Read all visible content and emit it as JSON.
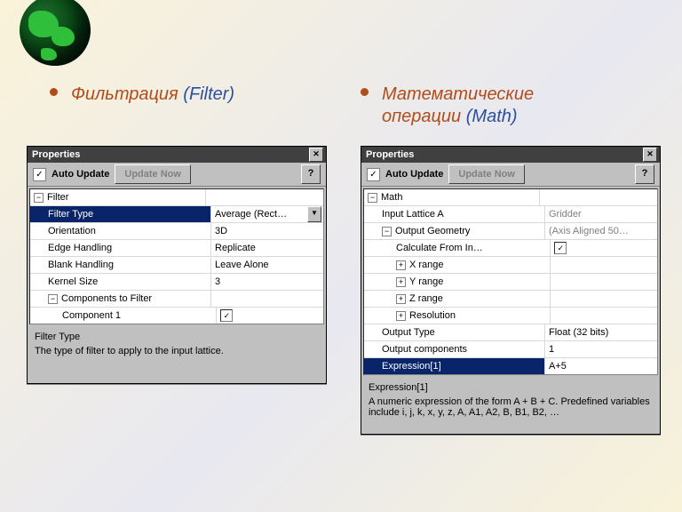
{
  "top": {
    "filter_heading": "Фильтрация",
    "filter_paren": " (Filter)",
    "math_heading": "Математические операции",
    "math_paren": " (Math)"
  },
  "filter_panel": {
    "title": "Properties",
    "auto_update": "Auto Update",
    "update_now": "Update Now",
    "help": "?",
    "root": "Filter",
    "rows": {
      "filter_type_l": "Filter Type",
      "filter_type_r": "Average (Rect…",
      "orient_l": "Orientation",
      "orient_r": "3D",
      "edge_l": "Edge Handling",
      "edge_r": "Replicate",
      "blank_l": "Blank Handling",
      "blank_r": "Leave Alone",
      "kernel_l": "Kernel Size",
      "kernel_r": "3",
      "comp_l": "Components to Filter",
      "comp1_l": "Component 1"
    },
    "desc_title": "Filter Type",
    "desc_body": "The type of filter to apply to the input lattice."
  },
  "math_panel": {
    "title": "Properties",
    "auto_update": "Auto Update",
    "update_now": "Update Now",
    "help": "?",
    "root": "Math",
    "rows": {
      "inputA_l": "Input Lattice A",
      "inputA_r": "Gridder",
      "og_l": "Output Geometry",
      "og_r": "(Axis Aligned 50…",
      "calc_l": "Calculate From In…",
      "xr_l": "X range",
      "yr_l": "Y range",
      "zr_l": "Z range",
      "res_l": "Resolution",
      "otype_l": "Output Type",
      "otype_r": "Float (32 bits)",
      "ocomp_l": "Output components",
      "ocomp_r": "1",
      "expr_l": "Expression[1]",
      "expr_r": "A+5"
    },
    "desc_title": "Expression[1]",
    "desc_body": "A numeric expression of the form A + B + C. Predefined variables include i, j, k, x, y, z, A, A1, A2, B, B1, B2, …"
  }
}
